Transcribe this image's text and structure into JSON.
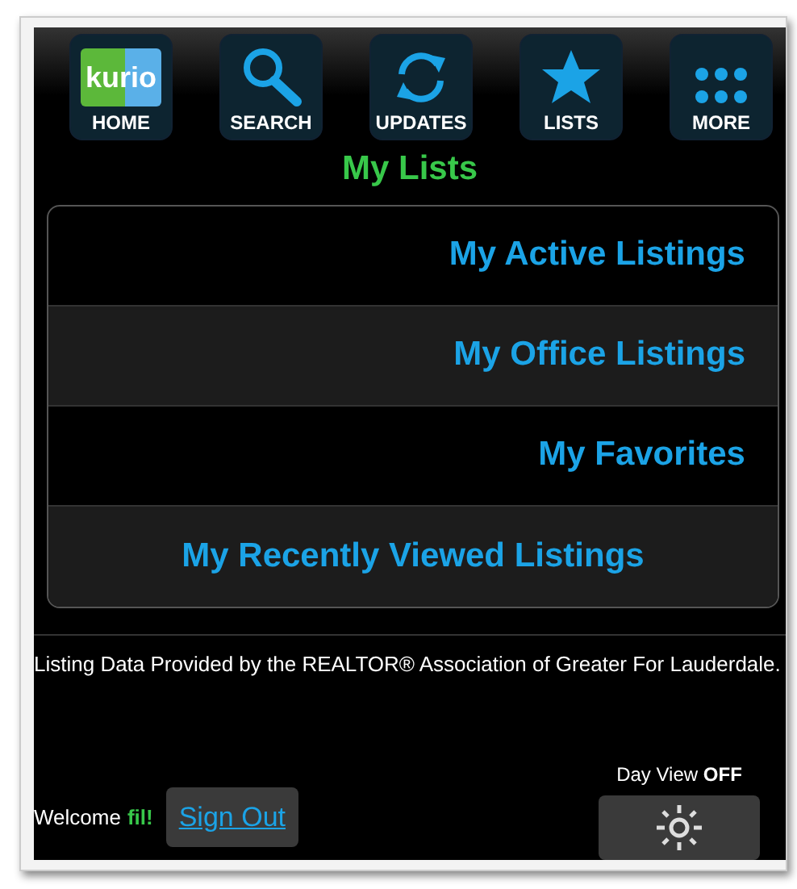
{
  "nav": [
    {
      "kind": "home",
      "label": "HOME",
      "logo": "kurio"
    },
    {
      "kind": "search",
      "label": "SEARCH"
    },
    {
      "kind": "updates",
      "label": "UPDATES"
    },
    {
      "kind": "lists",
      "label": "LISTS"
    },
    {
      "kind": "more",
      "label": "MORE"
    }
  ],
  "title": "My Lists",
  "lists": [
    "My Active Listings",
    "My Office Listings",
    "My Favorites",
    "My Recently Viewed Listings"
  ],
  "disclaimer": "Listing Data Provided by the REALTOR® Association of Greater For Lauderdale.",
  "welcome": {
    "greeting": "Welcome",
    "user": "fil!"
  },
  "sign_out": "Sign Out",
  "day_view": {
    "label": "Day View **OFF**"
  }
}
